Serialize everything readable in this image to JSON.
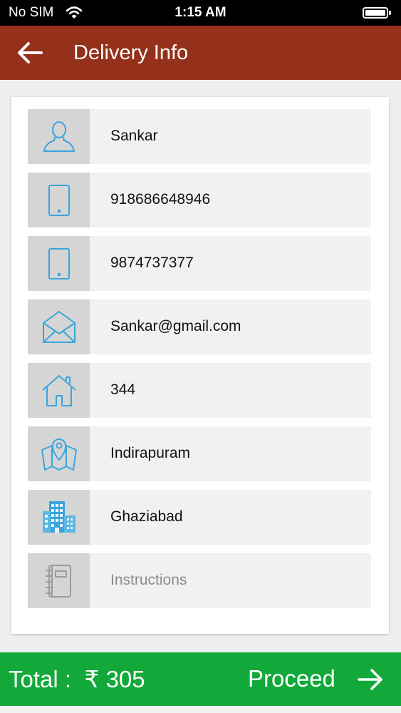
{
  "status_bar": {
    "carrier": "No SIM",
    "time": "1:15 AM"
  },
  "header": {
    "title": "Delivery Info"
  },
  "fields": [
    {
      "icon": "user-icon",
      "value": "Sankar",
      "placeholder": ""
    },
    {
      "icon": "mobile-icon",
      "value": "918686648946",
      "placeholder": ""
    },
    {
      "icon": "mobile-icon",
      "value": "9874737377",
      "placeholder": ""
    },
    {
      "icon": "envelope-icon",
      "value": "Sankar@gmail.com",
      "placeholder": ""
    },
    {
      "icon": "house-icon",
      "value": "344",
      "placeholder": ""
    },
    {
      "icon": "map-pin-icon",
      "value": "Indirapuram",
      "placeholder": ""
    },
    {
      "icon": "building-icon",
      "value": "Ghaziabad",
      "placeholder": ""
    },
    {
      "icon": "notebook-icon",
      "value": "",
      "placeholder": "Instructions"
    }
  ],
  "footer": {
    "total_label": "Total :",
    "currency": "₹",
    "total_amount": "305",
    "proceed_label": "Proceed"
  },
  "colors": {
    "header": "#95301a",
    "footer": "#12a93a",
    "icon": "#3aa5dc",
    "icon_muted": "#9a9a9a"
  }
}
